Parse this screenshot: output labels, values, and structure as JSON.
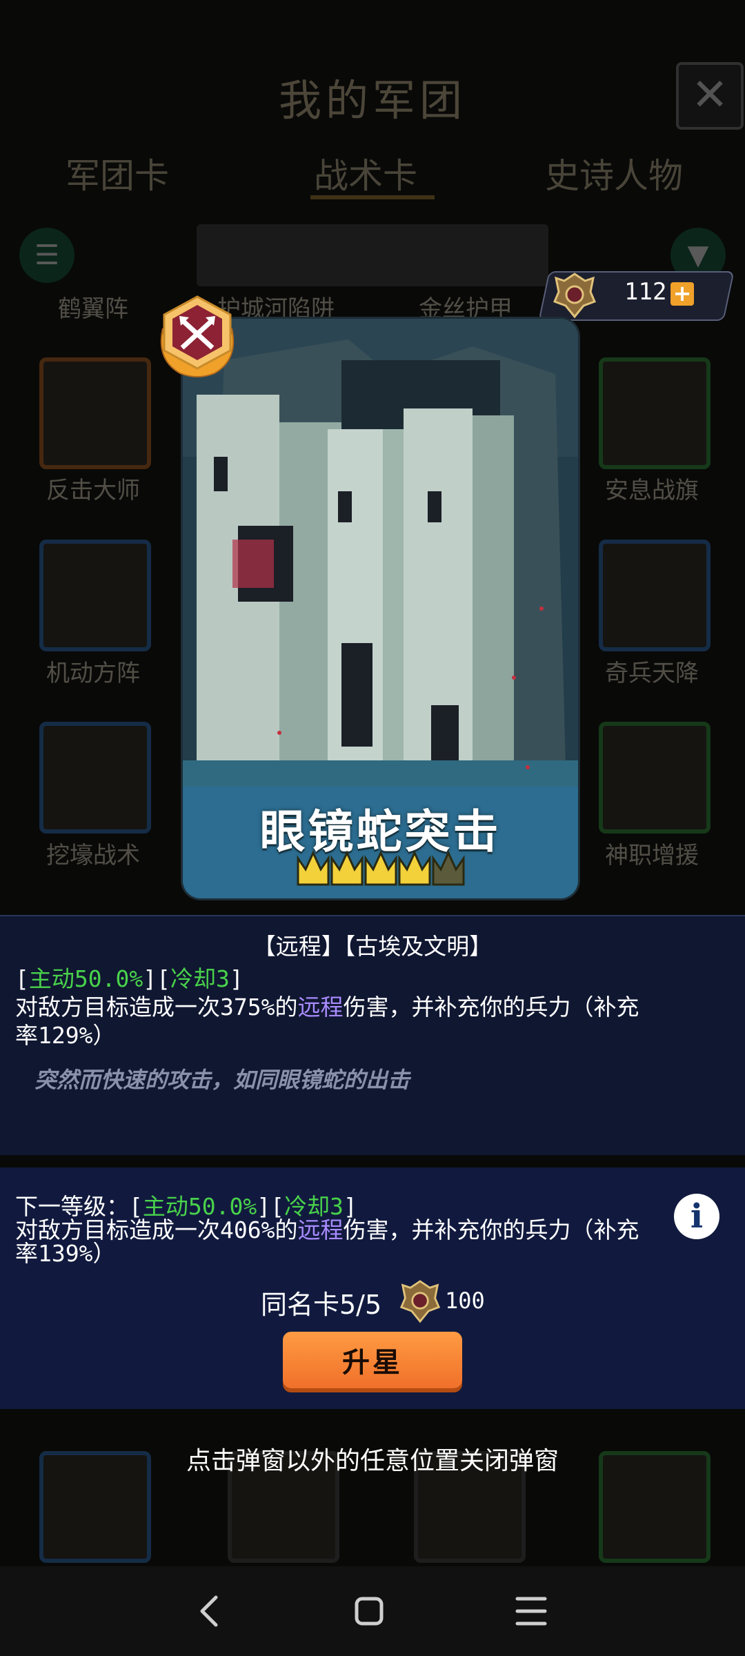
{
  "background": {
    "title": "我的军团",
    "tabs": [
      "军团卡",
      "战术卡",
      "史诗人物"
    ],
    "top_labels": [
      "鹤翼阵",
      "护城河陷阱",
      "金丝护甲"
    ],
    "left_labels": [
      "反击大师",
      "机动方阵",
      "挖壕战术"
    ],
    "right_labels": [
      "安息战旗",
      "奇兵天降",
      "神职增援"
    ]
  },
  "resource": {
    "count": "112",
    "plus": "+"
  },
  "card": {
    "name": "眼镜蛇突击",
    "stars": 4,
    "max_stars": 5
  },
  "description": {
    "tags": "【远程】【古埃及文明】",
    "current": {
      "bracket_open": "[",
      "active": "主动50.0%",
      "mid": "][",
      "cooldown": "冷却3",
      "bracket_close": "]",
      "line1_a": "对敌方目标造成一次375%的",
      "line1_kw": "远程",
      "line1_b": "伤害，并补充你的兵力（补充",
      "line2": "率129%）"
    },
    "flavor": "突然而快速的攻击，如同眼镜蛇的出击"
  },
  "next_level": {
    "prefix": "下一等级：[",
    "active": "主动50.0%",
    "mid": "][",
    "cooldown": "冷却3",
    "bracket_close": "]",
    "line1_a": "对敌方目标造成一次406%的",
    "line1_kw": "远程",
    "line1_b": "伤害，并补充你的兵力（补充",
    "line2": "率139%）"
  },
  "upgrade": {
    "duplicate_label": "同名卡5/5",
    "cost": "100",
    "button": "升星"
  },
  "close_hint": "点击弹窗以外的任意位置关闭弹窗",
  "colors": {
    "accent_green": "#49d24b",
    "keyword_purple": "#a98bff",
    "button_orange": "#f0702a"
  },
  "icons": [
    "close-icon",
    "list-icon",
    "filter-icon",
    "emblem-icon",
    "plus-icon",
    "crossed-arrows-badge-icon",
    "crown-icon",
    "info-icon",
    "back-icon",
    "home-icon",
    "menu-icon"
  ]
}
